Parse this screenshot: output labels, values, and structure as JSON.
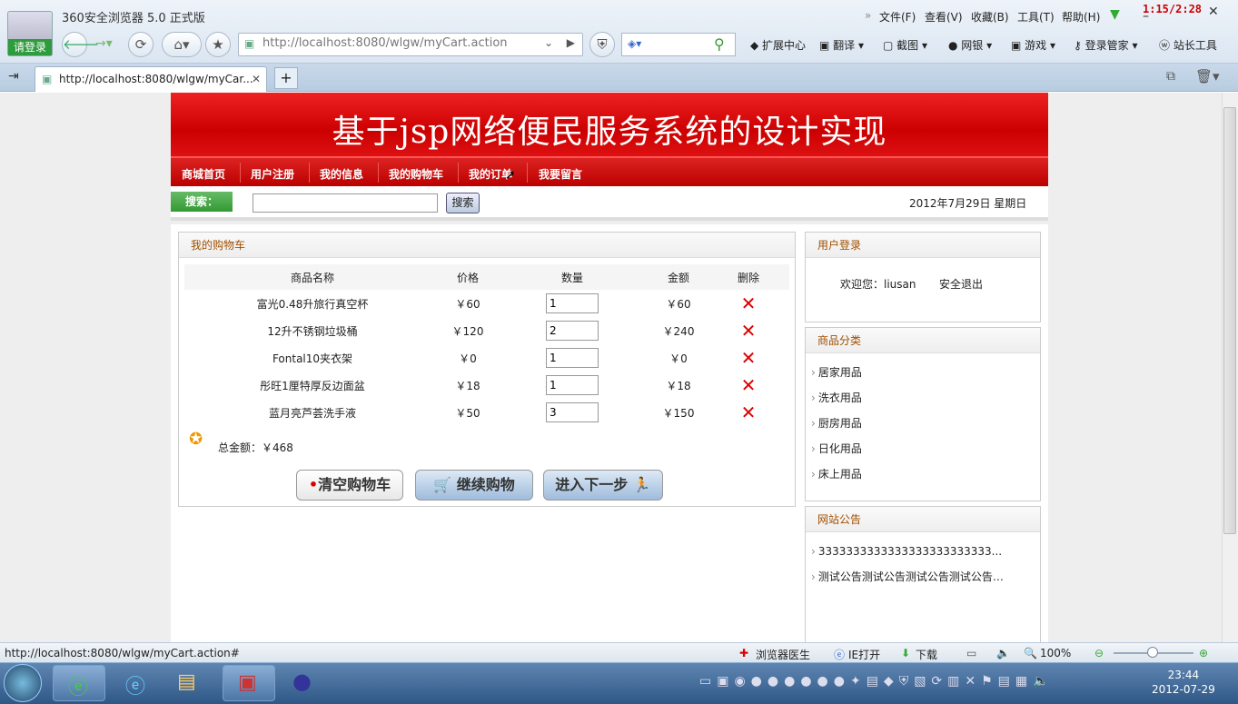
{
  "browser": {
    "app_title": "360安全浏览器 5.0 正式版",
    "login_label": "请登录",
    "menus": [
      "文件(F)",
      "查看(V)",
      "收藏(B)",
      "工具(T)",
      "帮助(H)"
    ],
    "timer": "1:15/2:28",
    "address": "http://localhost:8080/wlgw/myCart.action",
    "toolbar": [
      "扩展中心",
      "翻译",
      "截图",
      "网银",
      "游戏",
      "登录管家",
      "站长工具"
    ],
    "tab_title": "http://localhost:8080/wlgw/myCar..."
  },
  "site": {
    "banner_title": "基于jsp网络便民服务系统的设计实现",
    "nav": [
      "商城首页",
      "用户注册",
      "我的信息",
      "我的购物车",
      "我的订单",
      "我要留言"
    ],
    "search_label": "搜索：",
    "search_button": "搜索",
    "date": "2012年7月29日 星期日"
  },
  "cart": {
    "title": "我的购物车",
    "headers": [
      "商品名称",
      "价格",
      "数量",
      "金额",
      "删除"
    ],
    "rows": [
      {
        "name": "富光0.48升旅行真空杯",
        "price": "￥60",
        "qty": "1",
        "amount": "￥60"
      },
      {
        "name": "12升不锈钢垃圾桶",
        "price": "￥120",
        "qty": "2",
        "amount": "￥240"
      },
      {
        "name": "Fontal10夹衣架",
        "price": "￥0",
        "qty": "1",
        "amount": "￥0"
      },
      {
        "name": "彤旺1厘特厚反边面盆",
        "price": "￥18",
        "qty": "1",
        "amount": "￥18"
      },
      {
        "name": "蓝月亮芦荟洗手液",
        "price": "￥50",
        "qty": "3",
        "amount": "￥150"
      }
    ],
    "total_label": "总金额：￥468",
    "buttons": {
      "clear": "清空购物车",
      "continue": "继续购物",
      "next": "进入下一步"
    }
  },
  "sidebar": {
    "login_title": "用户登录",
    "welcome": "欢迎您：liusan",
    "logout": "安全退出",
    "category_title": "商品分类",
    "categories": [
      "居家用品",
      "洗衣用品",
      "厨房用品",
      "日化用品",
      "床上用品"
    ],
    "notice_title": "网站公告",
    "notices": [
      "3333333333333333333333333...",
      "测试公告测试公告测试公告测试公告…"
    ]
  },
  "status": {
    "url": "http://localhost:8080/wlgw/myCart.action#",
    "doctor": "浏览器医生",
    "ie_open": "IE打开",
    "download": "下载",
    "zoom": "100%"
  },
  "taskbar": {
    "time": "23:44",
    "date": "2012-07-29"
  },
  "colors": {
    "banner_red": "#cc0000",
    "nav_red": "#bb0000",
    "accent_orange": "#a05000"
  }
}
